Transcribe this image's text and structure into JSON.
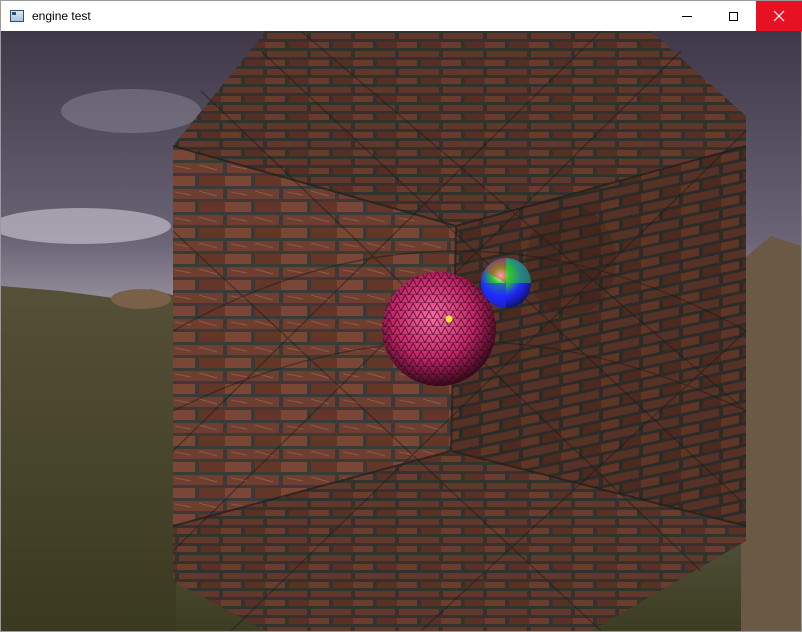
{
  "window": {
    "title": "engine test",
    "icon": "app-window-icon",
    "controls": {
      "minimize_icon": "minimize-icon",
      "maximize_icon": "maximize-icon",
      "close_icon": "close-icon",
      "close_bg": "#e81123"
    }
  },
  "scene": {
    "sky_colors": [
      "#4a4252",
      "#8a8392",
      "#bdb9c3"
    ],
    "ground_colors": [
      "#4d4a35",
      "#3c3d22",
      "#5b5333"
    ],
    "brick_color": "#6e3f30",
    "mortar_color": "#3b3a36",
    "pink_sphere_color": "#c8236a",
    "rgb_sphere_colors": [
      "#ff2020",
      "#1f2bff",
      "#2fc42f"
    ]
  }
}
